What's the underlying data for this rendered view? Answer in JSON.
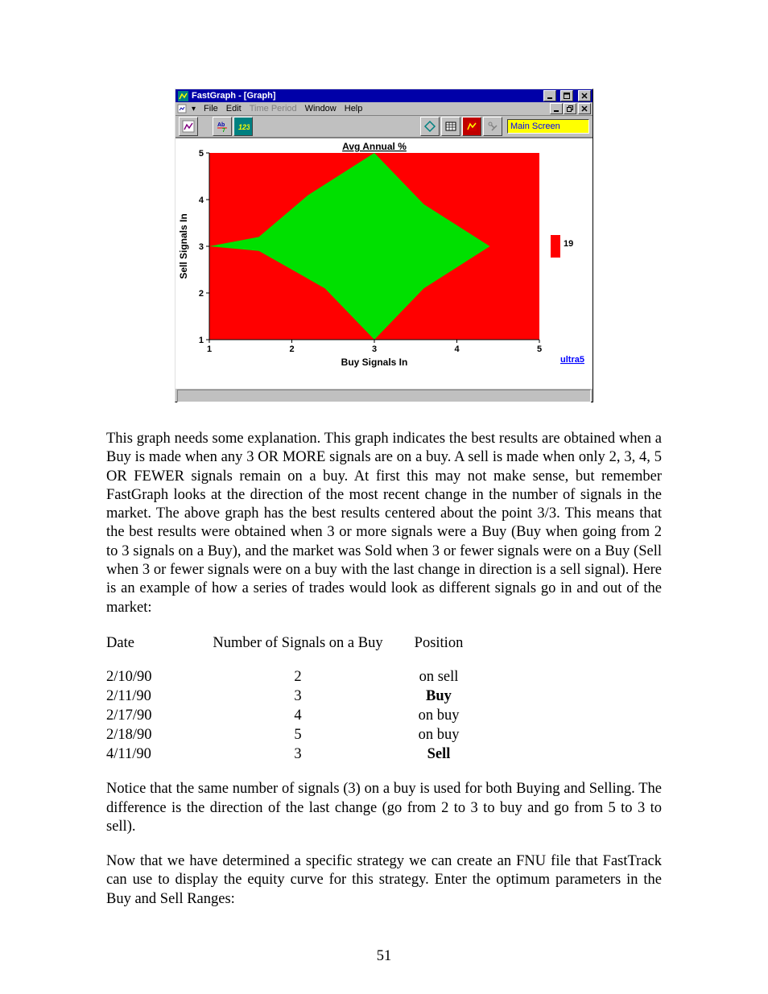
{
  "app": {
    "title": "FastGraph - [Graph]",
    "menus": {
      "file": "File",
      "edit": "Edit",
      "time_period": "Time Period",
      "window": "Window",
      "help": "Help"
    },
    "main_screen_label": "Main Screen"
  },
  "chart_data": {
    "type": "heatmap",
    "title": "Avg Annual %",
    "xlabel": "Buy Signals In",
    "ylabel": "Sell Signals In",
    "x_ticks": [
      1,
      2,
      3,
      4,
      5
    ],
    "y_ticks": [
      1,
      2,
      3,
      4,
      5
    ],
    "legend": {
      "value": 19,
      "label": "ultra5",
      "color_high": "#ff0000",
      "color_low": "#00e000"
    },
    "green_polygon_xy": [
      [
        3.0,
        5.0
      ],
      [
        2.2,
        4.1
      ],
      [
        1.6,
        3.2
      ],
      [
        1.0,
        3.0
      ],
      [
        1.6,
        2.9
      ],
      [
        2.4,
        2.1
      ],
      [
        3.0,
        1.0
      ],
      [
        3.6,
        2.1
      ],
      [
        4.4,
        3.0
      ],
      [
        3.6,
        3.9
      ]
    ],
    "xlim": [
      1,
      5
    ],
    "ylim": [
      1,
      5
    ]
  },
  "paragraphs": {
    "p1": "This graph needs some explanation.  This graph indicates the best results are obtained when a Buy is made when any 3 OR MORE signals are on a buy.  A sell is made when only 2, 3, 4, 5 OR FEWER signals remain on a buy.  At first this may not make sense, but remember FastGraph looks at the direction of the most recent change in the number of signals in the market.  The above graph has the best results centered about the point 3/3.  This means that the best results were obtained when  3 or more signals were a Buy (Buy when going from 2 to 3 signals on a Buy), and the market was Sold when 3 or fewer signals were on a Buy (Sell when 3 or fewer signals were on a buy with the last change in direction is a sell signal).  Here is an example of how a series of trades would look as different signals go in and out of the market:",
    "p2": "Notice that the same number of signals (3) on a buy is used for both Buying and Selling.  The difference is the direction of the last change (go from 2 to 3 to buy and go from 5 to 3 to sell).",
    "p3": "Now that we have determined a specific strategy we can create an FNU file that FastTrack can use to display the equity curve for this strategy.  Enter the optimum parameters in the Buy and Sell Ranges:"
  },
  "table": {
    "headers": {
      "c1": "Date",
      "c2": "Number of Signals on a Buy",
      "c3": "Position"
    },
    "rows": [
      {
        "date": "2/10/90",
        "n": "2",
        "pos": "on sell",
        "bold": false
      },
      {
        "date": "2/11/90",
        "n": "3",
        "pos": "Buy",
        "bold": true
      },
      {
        "date": "2/17/90",
        "n": "4",
        "pos": "on buy",
        "bold": false
      },
      {
        "date": "2/18/90",
        "n": "5",
        "pos": "on buy",
        "bold": false
      },
      {
        "date": "4/11/90",
        "n": "3",
        "pos": "Sell",
        "bold": true
      }
    ]
  },
  "page_number": "51"
}
